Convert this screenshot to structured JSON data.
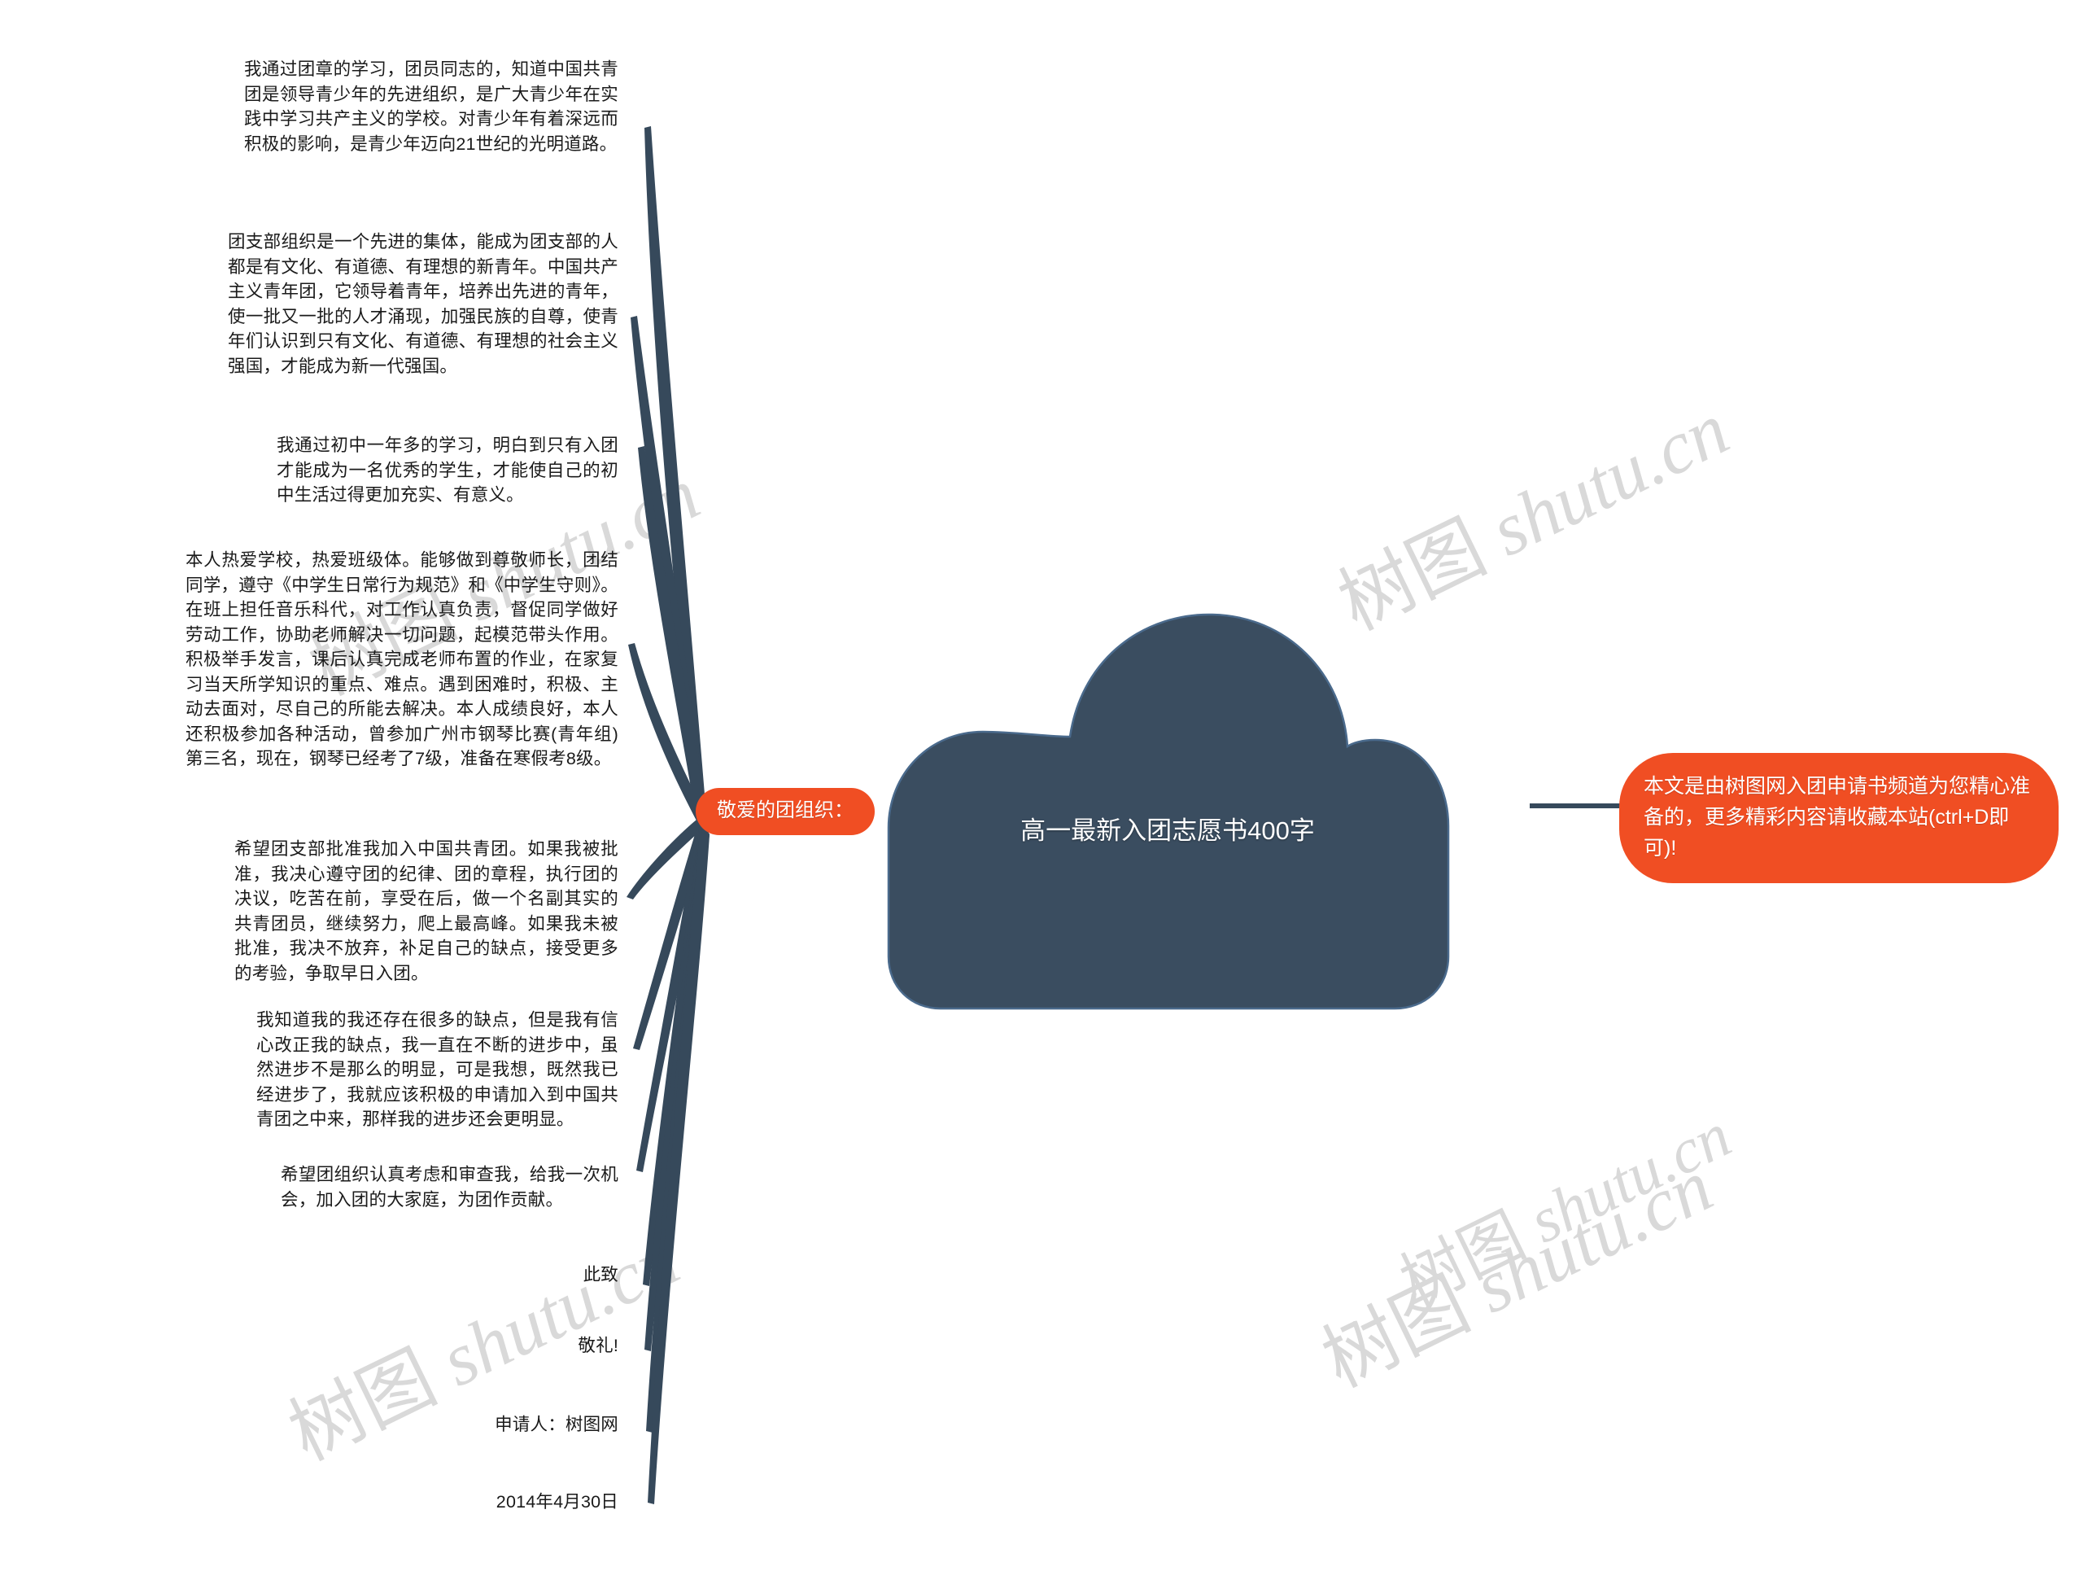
{
  "colors": {
    "accent_orange": "#f04e23",
    "node_dark_blue": "#3a4d60",
    "connector": "#36495b",
    "watermark": "#d9d9d9",
    "background": "#ffffff",
    "body_text": "#1a1a1a"
  },
  "center_node": {
    "title": "高一最新入团志愿书400字"
  },
  "salutation_node": {
    "label": "敬爱的团组织："
  },
  "promo_node": {
    "text": "本文是由树图网入团申请书频道为您精心准备的，更多精彩内容请收藏本站(ctrl+D即可)!"
  },
  "branches": [
    {
      "id": "branch-1",
      "text": "我通过团章的学习，团员同志的，知道中国共青团是领导青少年的先进组织，是广大青少年在实践中学习共产主义的学校。对青少年有着深远而积极的影响，是青少年迈向21世纪的光明道路。"
    },
    {
      "id": "branch-2",
      "text": "团支部组织是一个先进的集体，能成为团支部的人都是有文化、有道德、有理想的新青年。中国共产主义青年团，它领导着青年，培养出先进的青年，使一批又一批的人才涌现，加强民族的自尊，使青年们认识到只有文化、有道德、有理想的社会主义强国，才能成为新一代强国。"
    },
    {
      "id": "branch-3",
      "text": "我通过初中一年多的学习，明白到只有入团才能成为一名优秀的学生，才能使自己的初中生活过得更加充实、有意义。"
    },
    {
      "id": "branch-4",
      "text": "本人热爱学校，热爱班级体。能够做到尊敬师长，团结同学，遵守《中学生日常行为规范》和《中学生守则》。在班上担任音乐科代，对工作认真负责，督促同学做好劳动工作，协助老师解决一切问题，起模范带头作用。积极举手发言，课后认真完成老师布置的作业，在家复习当天所学知识的重点、难点。遇到困难时，积极、主动去面对，尽自己的所能去解决。本人成绩良好，本人还积极参加各种活动，曾参加广州市钢琴比赛(青年组)第三名，现在，钢琴已经考了7级，准备在寒假考8级。"
    },
    {
      "id": "branch-5",
      "text": "希望团支部批准我加入中国共青团。如果我被批准，我决心遵守团的纪律、团的章程，执行团的决议，吃苦在前，享受在后，做一个名副其实的共青团员，继续努力，爬上最高峰。如果我未被批准，我决不放弃，补足自己的缺点，接受更多的考验，争取早日入团。"
    },
    {
      "id": "branch-6",
      "text": "我知道我的我还存在很多的缺点，但是我有信心改正我的缺点，我一直在不断的进步中，虽然进步不是那么的明显，可是我想，既然我已经进步了，我就应该积极的申请加入到中国共青团之中来，那样我的进步还会更明显。"
    },
    {
      "id": "branch-7",
      "text": "希望团组织认真考虑和审查我，给我一次机会，加入团的大家庭，为团作贡献。"
    },
    {
      "id": "branch-8",
      "text": "此致"
    },
    {
      "id": "branch-9",
      "text": "敬礼!"
    },
    {
      "id": "branch-10",
      "text": "申请人：树图网"
    },
    {
      "id": "branch-11",
      "text": "2014年4月30日"
    }
  ],
  "watermarks": [
    {
      "cn": "树图",
      "en": " shutu.cn"
    },
    {
      "cn": "树图",
      "en": " shutu.cn"
    },
    {
      "cn": "树图",
      "en": " shutu.cn"
    },
    {
      "cn": "树图",
      "en": " shutu.cn"
    },
    {
      "cn": "树图",
      "en": " shutu.cn"
    }
  ]
}
